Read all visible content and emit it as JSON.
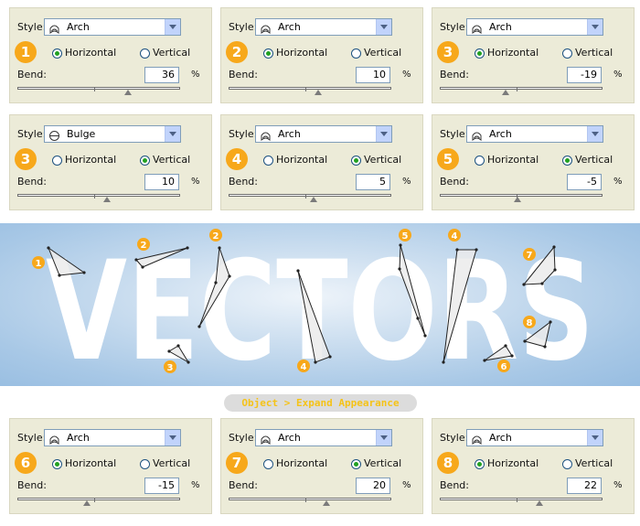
{
  "panels": [
    {
      "num": "1",
      "style": "Arch",
      "orientation": "Horizontal",
      "bend": "36",
      "bend_value": 36
    },
    {
      "num": "2",
      "style": "Arch",
      "orientation": "Horizontal",
      "bend": "10",
      "bend_value": 10
    },
    {
      "num": "3",
      "style": "Arch",
      "orientation": "Horizontal",
      "bend": "-19",
      "bend_value": -19
    },
    {
      "num": "3",
      "style": "Bulge",
      "orientation": "Vertical",
      "bend": "10",
      "bend_value": 10
    },
    {
      "num": "4",
      "style": "Arch",
      "orientation": "Vertical",
      "bend": "5",
      "bend_value": 5
    },
    {
      "num": "5",
      "style": "Arch",
      "orientation": "Vertical",
      "bend": "-5",
      "bend_value": -5
    },
    {
      "num": "6",
      "style": "Arch",
      "orientation": "Horizontal",
      "bend": "-15",
      "bend_value": -15
    },
    {
      "num": "7",
      "style": "Arch",
      "orientation": "Vertical",
      "bend": "20",
      "bend_value": 20
    },
    {
      "num": "8",
      "style": "Arch",
      "orientation": "Horizontal",
      "bend": "22",
      "bend_value": 22
    }
  ],
  "labels": {
    "style": "Style:",
    "horizontal": "Horizontal",
    "vertical": "Vertical",
    "bend": "Bend:",
    "percent": "%"
  },
  "banner": {
    "word": "VECTORS",
    "markers": [
      "1",
      "2",
      "2",
      "3",
      "4",
      "5",
      "4",
      "6",
      "7",
      "8"
    ]
  },
  "command": "Object > Expand Appearance",
  "colors": {
    "panel_bg": "#ecebd8",
    "badge": "#f7a81b",
    "radio_on": "#21a121",
    "command_text": "#f5c318"
  }
}
